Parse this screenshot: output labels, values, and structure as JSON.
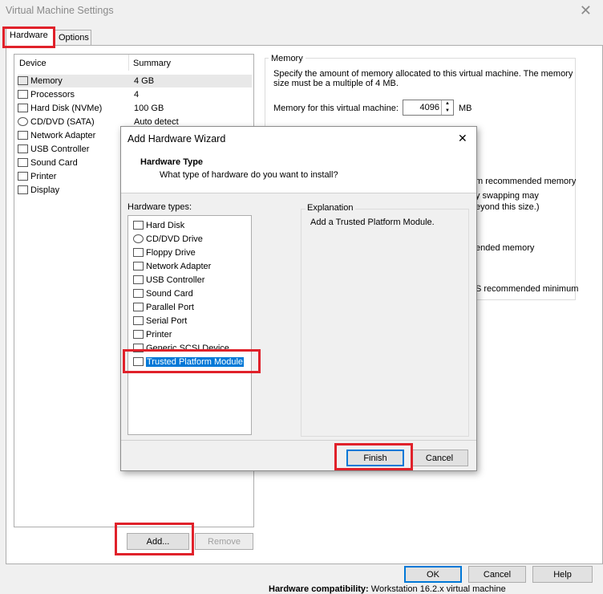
{
  "window": {
    "title": "Virtual Machine Settings",
    "close": "✕"
  },
  "tabs": {
    "hardware": "Hardware",
    "options": "Options"
  },
  "device_list": {
    "col_device": "Device",
    "col_summary": "Summary",
    "rows": [
      {
        "name": "Memory",
        "summary": "4 GB"
      },
      {
        "name": "Processors",
        "summary": "4"
      },
      {
        "name": "Hard Disk (NVMe)",
        "summary": "100 GB"
      },
      {
        "name": "CD/DVD (SATA)",
        "summary": "Auto detect"
      },
      {
        "name": "Network Adapter",
        "summary": ""
      },
      {
        "name": "USB Controller",
        "summary": ""
      },
      {
        "name": "Sound Card",
        "summary": ""
      },
      {
        "name": "Printer",
        "summary": ""
      },
      {
        "name": "Display",
        "summary": ""
      }
    ]
  },
  "add_button": "Add...",
  "remove_button": "Remove",
  "memory": {
    "group": "Memory",
    "desc1": "Specify the amount of memory allocated to this virtual machine. The memory",
    "desc2": "size must be a multiple of 4 MB.",
    "label": "Memory for this virtual machine:",
    "value": "4096",
    "unit": "MB",
    "frag1": "m recommended memory",
    "frag2": "y swapping may",
    "frag3": "eyond this size.)",
    "frag4": "ended memory",
    "frag5": "S recommended minimum"
  },
  "footer": {
    "ok": "OK",
    "cancel": "Cancel",
    "help": "Help",
    "compat_label": "Hardware compatibility:",
    "compat_value": "Workstation 16.2.x virtual machine"
  },
  "wizard": {
    "title": "Add Hardware Wizard",
    "close": "✕",
    "heading": "Hardware Type",
    "subheading": "What type of hardware do you want to install?",
    "types_label": "Hardware types:",
    "types": [
      "Hard Disk",
      "CD/DVD Drive",
      "Floppy Drive",
      "Network Adapter",
      "USB Controller",
      "Sound Card",
      "Parallel Port",
      "Serial Port",
      "Printer",
      "Generic SCSI Device",
      "Trusted Platform Module"
    ],
    "selected": "Trusted Platform Module",
    "explanation_label": "Explanation",
    "explanation_text": "Add a Trusted Platform Module.",
    "finish": "Finish",
    "cancel": "Cancel"
  },
  "accent_colors": {
    "selection": "#0078d7",
    "highlight_box": "#e0212a"
  }
}
